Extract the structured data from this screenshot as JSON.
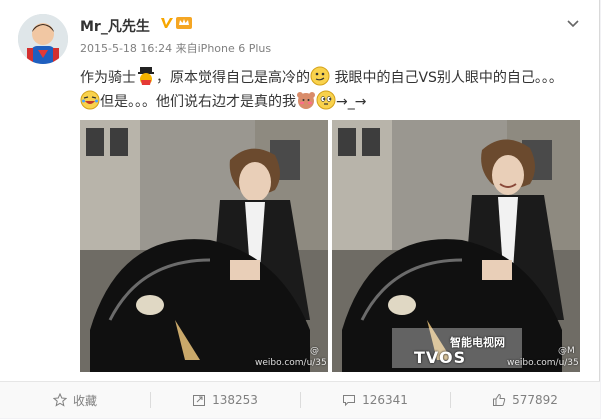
{
  "post": {
    "username": "Mr_凡先生",
    "meta_date": "2015-5-18 16:24",
    "meta_from": "来自",
    "meta_device": "iPhone 6 Plus",
    "text_part1": "作为骑士",
    "text_part2": "，原本觉得自己是高冷的",
    "text_part3": " 我眼中的自己VS别人眼中的自己。。。",
    "text_part4": "但是。。。他们说右边才是真的我",
    "text_part5": "→_→"
  },
  "photos": {
    "left_watermark": "weibo.com/u/35",
    "right_watermark": "weibo.com/u/35",
    "right_logo": "智能电视网",
    "right_logo_sub": "TVOS",
    "left_corner": "@",
    "right_corner": "@M"
  },
  "footer": {
    "favorite_label": "收藏",
    "repost_count": "138253",
    "comment_count": "126341",
    "like_count": "577892"
  },
  "colors": {
    "accent": "#eb7350",
    "text": "#333333",
    "muted": "#808080"
  }
}
